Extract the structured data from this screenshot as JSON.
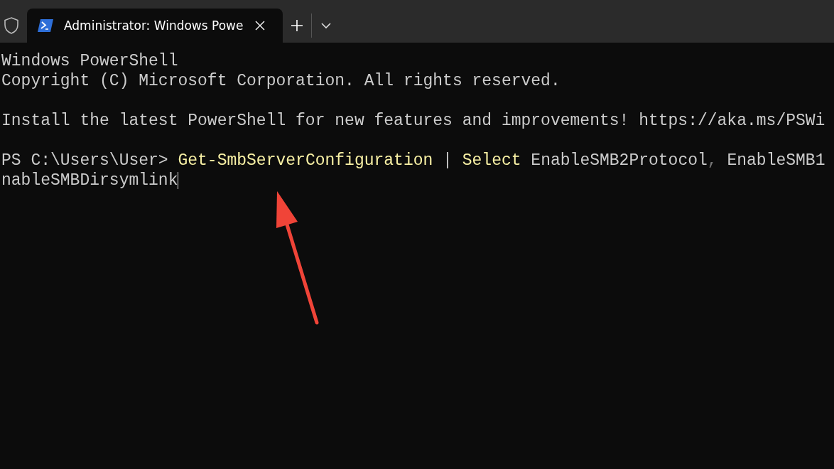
{
  "tabs": [
    {
      "title": "Administrator: Windows Powe",
      "selected": true
    }
  ],
  "terminal": {
    "blocks": [
      {
        "lines": [
          {
            "segments": [
              {
                "kind": "output",
                "text": "Windows PowerShell"
              }
            ]
          },
          {
            "segments": [
              {
                "kind": "output",
                "text": "Copyright (C) Microsoft Corporation. All rights reserved."
              }
            ]
          }
        ]
      },
      {
        "lines": [
          {
            "segments": [
              {
                "kind": "output",
                "text": "Install the latest PowerShell for new features and improvements! https://aka.ms/PSWi"
              }
            ]
          }
        ]
      },
      {
        "lines": [
          {
            "segments": [
              {
                "kind": "output",
                "text": "PS C:\\Users\\User> "
              },
              {
                "kind": "command",
                "text": "Get-SmbServerConfiguration"
              },
              {
                "kind": "output",
                "text": " | "
              },
              {
                "kind": "command",
                "text": "Select"
              },
              {
                "kind": "output",
                "text": " EnableSMB2Protocol"
              },
              {
                "kind": "operator",
                "text": ","
              },
              {
                "kind": "output",
                "text": " EnableSMB1"
              }
            ]
          },
          {
            "segments": [
              {
                "kind": "output",
                "text": "nableSMBDirsymlink"
              }
            ],
            "cursor": true
          }
        ]
      }
    ]
  }
}
